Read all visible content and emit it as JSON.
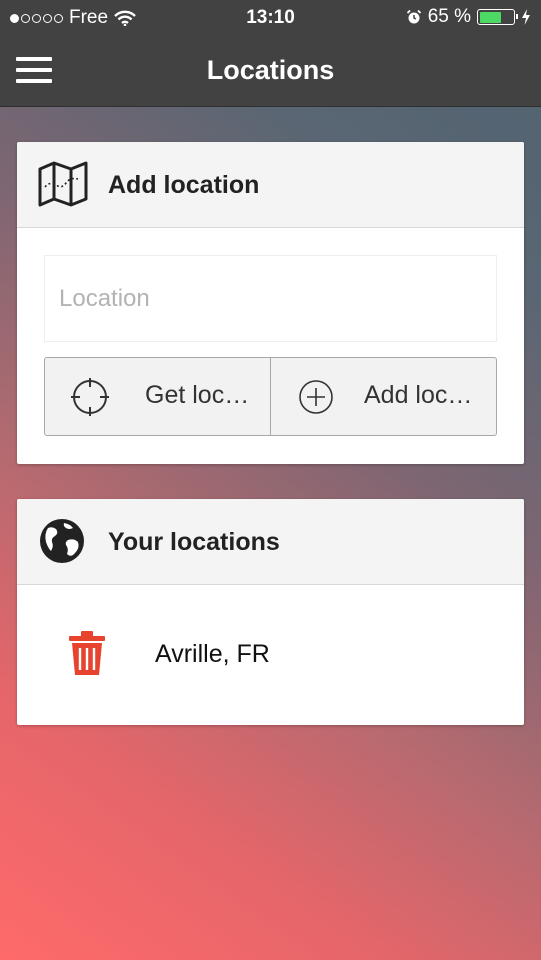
{
  "status_bar": {
    "carrier": "Free",
    "time": "13:10",
    "battery_percent": "65 %",
    "battery_level": 0.65,
    "signal_bars_filled": 1,
    "signal_bars_total": 5
  },
  "header": {
    "title": "Locations",
    "menu_icon": "hamburger-menu-icon"
  },
  "add_location": {
    "title": "Add location",
    "icon": "map-icon",
    "input_value": "",
    "input_placeholder": "Location",
    "get_location_label": "Get loc…",
    "get_location_icon": "crosshair-icon",
    "add_location_label": "Add loc…",
    "add_location_icon": "plus-circle-icon"
  },
  "your_locations": {
    "title": "Your locations",
    "icon": "globe-icon",
    "items": [
      {
        "name": "Avrille, FR",
        "delete_icon": "trash-icon"
      }
    ]
  },
  "colors": {
    "header_bg": "#424242",
    "battery_green": "#4cd964",
    "delete_red": "#e8432e",
    "card_head_bg": "#f4f4f4"
  }
}
